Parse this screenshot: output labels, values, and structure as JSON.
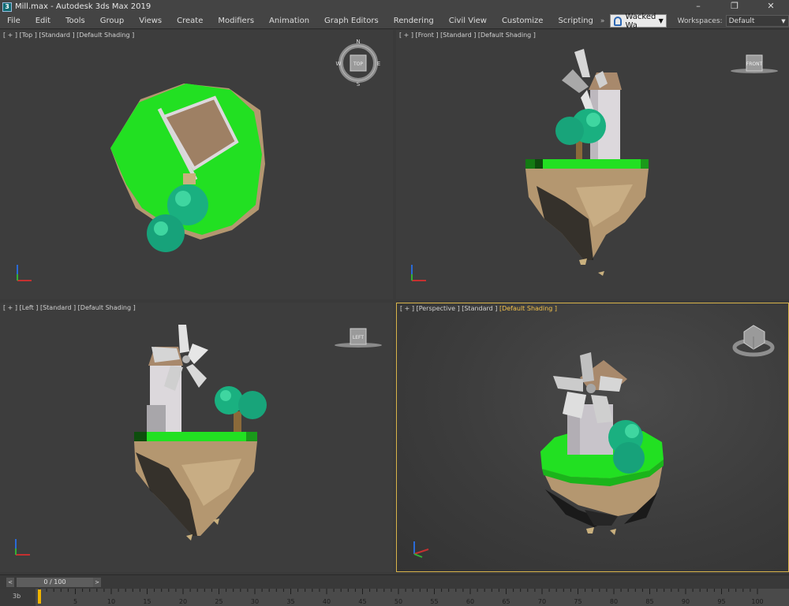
{
  "app": {
    "icon_label": "3",
    "title": "Mill.max - Autodesk 3ds Max 2019",
    "controls": {
      "minimize": "–",
      "maximize": "❐",
      "close": "✕"
    }
  },
  "menu": {
    "items": [
      "File",
      "Edit",
      "Tools",
      "Group",
      "Views",
      "Create",
      "Modifiers",
      "Animation",
      "Graph Editors",
      "Rendering",
      "Civil View",
      "Customize",
      "Scripting"
    ],
    "overflow": "»",
    "user": {
      "name": "Wacked Wa",
      "caret": "▼"
    },
    "workspaces_label": "Workspaces:",
    "workspace_value": "Default",
    "workspace_caret": "▼"
  },
  "viewports": {
    "top": {
      "label": "[ + ] [Top ] [Standard ] [Default Shading ]",
      "cube_label": "TOP",
      "compass": [
        "N",
        "E",
        "S",
        "W"
      ]
    },
    "front": {
      "label": "[ + ] [Front ] [Standard ] [Default Shading ]",
      "cube_label": "FRONT"
    },
    "left": {
      "label": "[ + ] [Left ] [Standard ] [Default Shading ]",
      "cube_label": "LEFT"
    },
    "perspective": {
      "label_prefix": "[ + ] [Perspective ] [Standard ] ",
      "label_active": "[Default Shading ]"
    }
  },
  "timeline": {
    "frame_display": "0 / 100",
    "prev": "<",
    "next": ">",
    "corner_label": "3b",
    "ticks": [
      "0",
      "5",
      "10",
      "15",
      "20",
      "25",
      "30",
      "35",
      "40",
      "45",
      "50",
      "55",
      "60",
      "65",
      "70",
      "75",
      "80",
      "85",
      "90",
      "95",
      "100"
    ]
  },
  "colors": {
    "grass": "#22e022",
    "rock": "#b49770",
    "tree": "#1ab080",
    "mill_wall": "#dcd8dc",
    "roof": "#a8896c",
    "viewport_bg": "#3d3d3d",
    "active_border": "#d9b44a"
  }
}
